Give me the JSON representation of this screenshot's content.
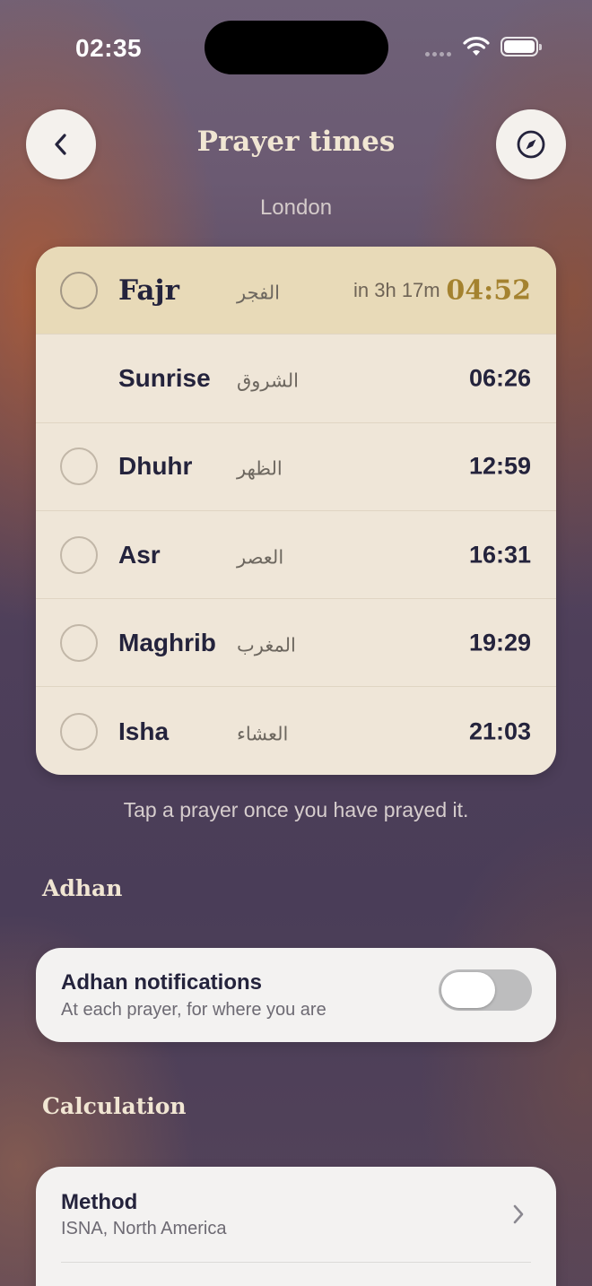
{
  "status_bar": {
    "time": "02:35"
  },
  "header": {
    "title": "Prayer times",
    "location": "London"
  },
  "prayers": [
    {
      "name": "Fajr",
      "arabic": "الفجر",
      "time": "04:52",
      "countdown": "in 3h 17m",
      "next": true,
      "checkable": true
    },
    {
      "name": "Sunrise",
      "arabic": "الشروق",
      "time": "06:26",
      "checkable": false
    },
    {
      "name": "Dhuhr",
      "arabic": "الظهر",
      "time": "12:59",
      "checkable": true
    },
    {
      "name": "Asr",
      "arabic": "العصر",
      "time": "16:31",
      "checkable": true
    },
    {
      "name": "Maghrib",
      "arabic": "المغرب",
      "time": "19:29",
      "checkable": true
    },
    {
      "name": "Isha",
      "arabic": "العشاء",
      "time": "21:03",
      "checkable": true
    }
  ],
  "hint": "Tap a prayer once you have prayed it.",
  "adhan": {
    "section_label": "Adhan",
    "title": "Adhan notifications",
    "subtitle": "At each prayer, for where you are",
    "enabled": false
  },
  "calculation": {
    "section_label": "Calculation",
    "method_title": "Method",
    "method_value": "ISNA, North America"
  },
  "colors": {
    "accent_gold": "#a4822f",
    "card_bg": "#efe6d8",
    "next_row_bg": "#e8dab8",
    "text_dark": "#24233c"
  },
  "icons": {
    "back": "chevron-left-icon",
    "compass": "compass-icon",
    "disclosure": "chevron-right-icon"
  }
}
